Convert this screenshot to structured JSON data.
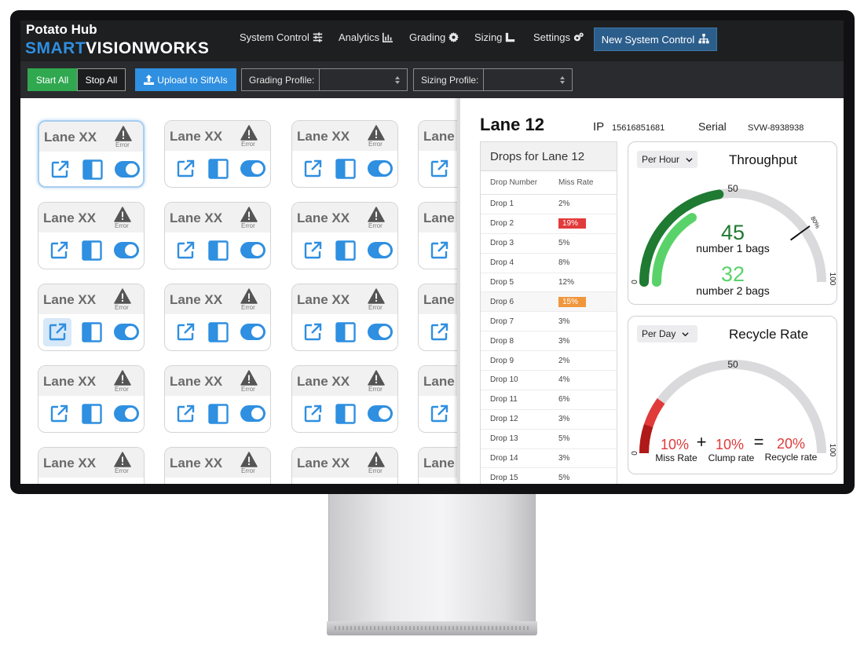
{
  "header": {
    "app_name": "Potato Hub",
    "brand_smart": "SMART",
    "brand_rest": "VISIONWORKS",
    "nav": [
      {
        "label": "System Control",
        "icon": "sliders-icon"
      },
      {
        "label": "Analytics",
        "icon": "bar-chart-icon"
      },
      {
        "label": "Grading",
        "icon": "gear-icon"
      },
      {
        "label": "Sizing",
        "icon": "ruler-icon"
      },
      {
        "label": "Settings",
        "icon": "gears-icon"
      }
    ],
    "new_system_control": "New System Control"
  },
  "toolbar": {
    "start_all": "Start All",
    "stop_all": "Stop All",
    "upload": "Upload to SiftAIs",
    "grading_profile_label": "Grading Profile:",
    "grading_profile_value": "",
    "sizing_profile_label": "Sizing Profile:",
    "sizing_profile_value": ""
  },
  "lanes": {
    "title": "Lane XX",
    "status": "Error"
  },
  "detail": {
    "title": "Lane 12",
    "ip_label": "IP",
    "ip": "15616851681",
    "serial_label": "Serial",
    "serial": "SVW-8938938",
    "drops": {
      "title": "Drops for Lane 12",
      "col_drop": "Drop Number",
      "col_miss": "Miss Rate",
      "rows": [
        {
          "drop": "Drop 1",
          "miss": "2%"
        },
        {
          "drop": "Drop 2",
          "miss": "19%"
        },
        {
          "drop": "Drop 3",
          "miss": "5%"
        },
        {
          "drop": "Drop 4",
          "miss": "8%"
        },
        {
          "drop": "Drop 5",
          "miss": "12%"
        },
        {
          "drop": "Drop 6",
          "miss": "15%"
        },
        {
          "drop": "Drop 7",
          "miss": "3%"
        },
        {
          "drop": "Drop 8",
          "miss": "3%"
        },
        {
          "drop": "Drop 9",
          "miss": "2%"
        },
        {
          "drop": "Drop 10",
          "miss": "4%"
        },
        {
          "drop": "Drop 11",
          "miss": "6%"
        },
        {
          "drop": "Drop 12",
          "miss": "3%"
        },
        {
          "drop": "Drop 13",
          "miss": "5%"
        },
        {
          "drop": "Drop 14",
          "miss": "3%"
        },
        {
          "drop": "Drop 15",
          "miss": "5%"
        }
      ],
      "colors": {
        "high": "#e23b3b",
        "medium": "#f0963c"
      }
    },
    "throughput": {
      "period": "Per Hour",
      "title": "Throughput",
      "scale_min": "0",
      "scale_mid": "50",
      "scale_max": "100",
      "mark_label": "80%",
      "mark_value": 80,
      "value1": "45",
      "value1_label": "number 1 bags",
      "value1_fraction": 0.45,
      "value2": "32",
      "value2_label": "number 2 bags",
      "value2_fraction": 0.32,
      "colors": {
        "value1": "#1f7a32",
        "value2": "#5ad26a",
        "track": "#dadadc"
      }
    },
    "recycle": {
      "period": "Per Day",
      "title": "Recycle Rate",
      "scale_min": "0",
      "scale_mid": "50",
      "scale_max": "100",
      "miss_value": "10%",
      "miss_label": "Miss Rate",
      "plus": "+",
      "clump_value": "10%",
      "clump_label": "Clump rate",
      "equals": "=",
      "recycle_value": "20%",
      "recycle_label": "Recycle rate",
      "miss_fraction": 0.1,
      "recycle_fraction": 0.2,
      "colors": {
        "miss": "#b01919",
        "recycle": "#e03a3a",
        "track": "#dadadc"
      }
    }
  }
}
